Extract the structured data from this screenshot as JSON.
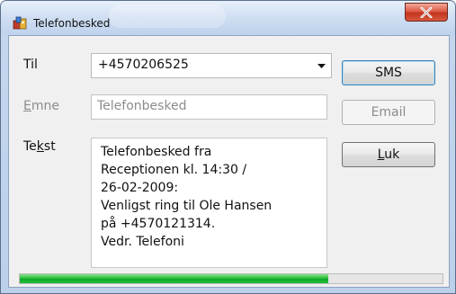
{
  "window": {
    "title": "Telefonbesked",
    "close_symbol": "X"
  },
  "form": {
    "to_label_pre": "Til",
    "to_value": "+4570206525",
    "subject_label_pre": "",
    "subject_label_accel": "E",
    "subject_label_post": "mne",
    "subject_value": "Telefonbesked",
    "text_label_pre": "Te",
    "text_label_accel": "k",
    "text_label_post": "st",
    "message_lines": [
      "Telefonbesked fra",
      "Receptionen kl. 14:30 /",
      "26-02-2009:",
      "Venligst ring til Ole Hansen",
      "på +4570121314.",
      "Vedr. Telefoni"
    ]
  },
  "buttons": {
    "sms_label": "SMS",
    "email_label": "Email",
    "close_accel": "L",
    "close_rest": "uk"
  },
  "progress": {
    "fraction": 0.73
  },
  "icons": {
    "app": "message-app-icon",
    "close": "close-icon",
    "dropdown": "chevron-down-icon"
  },
  "colors": {
    "close_button": "#c2341f",
    "progress_fill": "#0da72a",
    "default_button_border": "#3c7fb1"
  }
}
